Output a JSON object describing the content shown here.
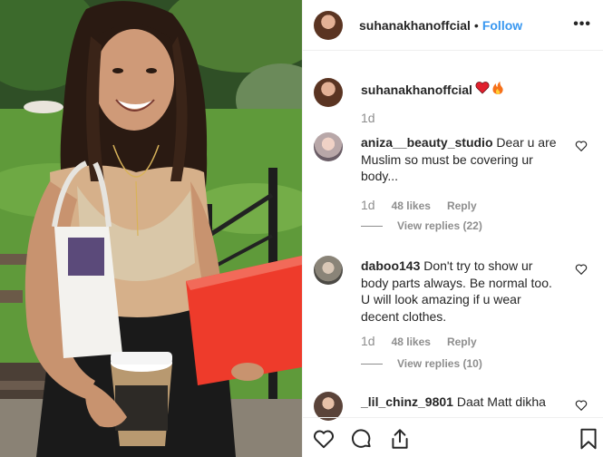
{
  "post": {
    "username": "suhanakhanoffcial",
    "separator": "•",
    "follow_label": "Follow",
    "more_label": "•••"
  },
  "caption": {
    "username": "suhanakhanoffcial",
    "emoji": "❤️🔥",
    "time": "1d"
  },
  "comments": [
    {
      "username": "aniza__beauty_studio",
      "text": "Dear u are Muslim so must be covering ur body...",
      "time": "1d",
      "likes": "48 likes",
      "reply_label": "Reply",
      "view_replies": "View replies (22)"
    },
    {
      "username": "daboo143",
      "text": "Don't try to show ur body parts always. Be normal too. U will look amazing if u wear decent clothes.",
      "time": "1d",
      "likes": "48 likes",
      "reply_label": "Reply",
      "view_replies": "View replies (10)"
    },
    {
      "username": "_lil_chinz_9801",
      "text": "Daat Matt dikha"
    }
  ],
  "icons": {
    "like": "heart-icon",
    "comment": "comment-icon",
    "share": "share-icon",
    "save": "bookmark-icon",
    "more": "more-options-icon"
  },
  "colors": {
    "link_blue": "#3897f0",
    "secondary_text": "#8e8e8e",
    "primary_text": "#262626",
    "divider": "#efefef"
  }
}
